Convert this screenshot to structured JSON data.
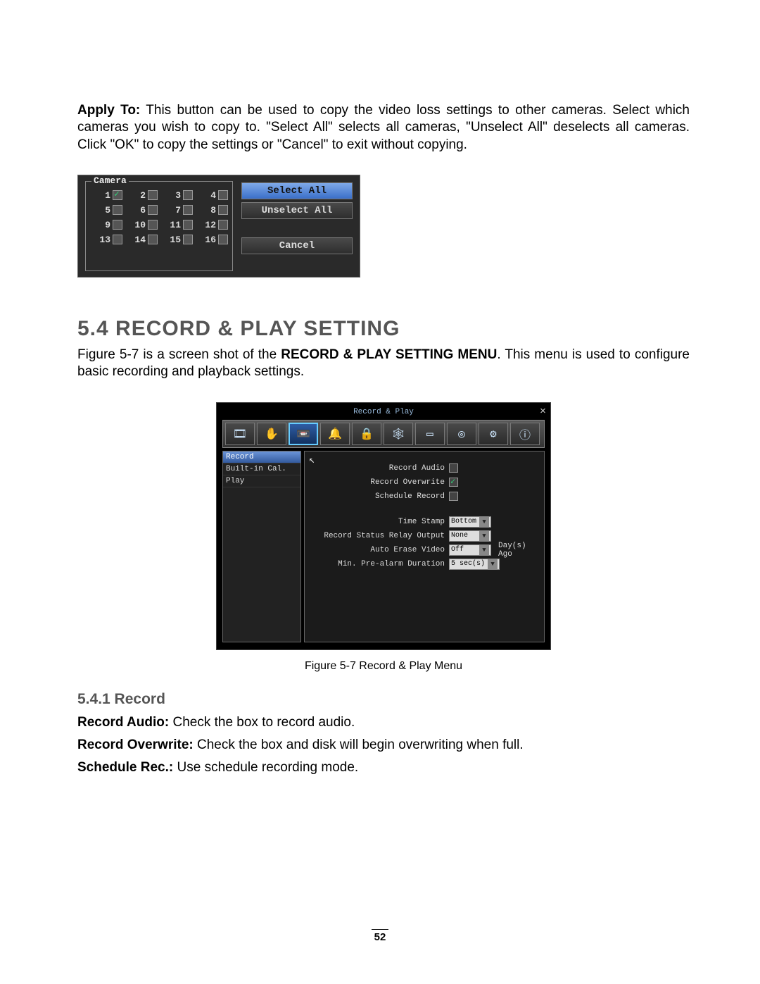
{
  "intro": {
    "apply_label": "Apply To:",
    "apply_text": " This button can be used to copy the video loss settings to other cameras. Select which cameras you wish to copy to. \"Select All\" selects all cameras, \"Unselect All\" deselects all cameras. Click \"OK\" to copy the settings or \"Cancel\" to exit without copying."
  },
  "camera_panel": {
    "legend": "Camera",
    "checked_camera": 1,
    "cameras": [
      "1",
      "2",
      "3",
      "4",
      "5",
      "6",
      "7",
      "8",
      "9",
      "10",
      "11",
      "12",
      "13",
      "14",
      "15",
      "16"
    ],
    "buttons": {
      "select_all": "Select All",
      "unselect_all": "Unselect All",
      "cancel": "Cancel"
    }
  },
  "section": {
    "num_title": "5.4  RECORD & PLAY SETTING",
    "para_prefix": "Figure 5-7 is a screen shot of the ",
    "para_bold": "RECORD & PLAY SETTING MENU",
    "para_suffix": ". This menu is used to configure basic recording and playback settings."
  },
  "rp": {
    "title": "Record & Play",
    "icons": [
      "clip",
      "hand",
      "cam",
      "bell",
      "lock",
      "net",
      "disp",
      "disk",
      "gear",
      "info"
    ],
    "active_icon_index": 2,
    "side": [
      "Record",
      "Built-in Cal.",
      "Play"
    ],
    "side_selected_index": 0,
    "rows": {
      "record_audio": {
        "label": "Record Audio",
        "checked": false
      },
      "record_overwrite": {
        "label": "Record Overwrite",
        "checked": true
      },
      "schedule_record": {
        "label": "Schedule Record",
        "checked": false
      },
      "time_stamp": {
        "label": "Time Stamp",
        "value": "Bottom"
      },
      "status_relay": {
        "label": "Record Status Relay Output",
        "value": "None"
      },
      "auto_erase": {
        "label": "Auto Erase Video",
        "value": "Off",
        "suffix": "Day(s) Ago"
      },
      "pre_alarm": {
        "label": "Min. Pre-alarm Duration",
        "value": "5 sec(s)"
      }
    }
  },
  "caption": "Figure 5-7  Record & Play Menu",
  "subsection": "5.4.1   Record",
  "items": {
    "audio": {
      "label": "Record Audio:",
      "text": " Check the box to record audio."
    },
    "overwrite": {
      "label": "Record Overwrite:",
      "text": " Check the box and disk will begin overwriting when full."
    },
    "schedule": {
      "label": "Schedule Rec.:",
      "text": " Use schedule recording mode."
    }
  },
  "page_number": "52"
}
